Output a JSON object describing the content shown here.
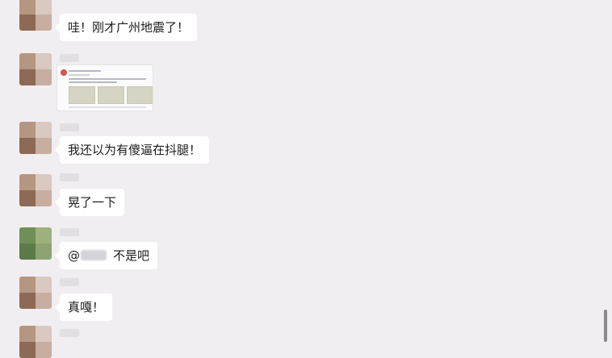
{
  "messages": [
    {
      "id": 1,
      "avatar": "blurred-avatar-brown",
      "text": "哇！刚才广州地震了！"
    },
    {
      "id": 2,
      "avatar": "blurred-avatar-brown",
      "type": "image",
      "image": "news-post-screenshot-thumbnail"
    },
    {
      "id": 3,
      "avatar": "blurred-avatar-brown",
      "text": "我还以为有傻逼在抖腿！"
    },
    {
      "id": 4,
      "avatar": "blurred-avatar-brown",
      "text": "晃了一下"
    },
    {
      "id": 5,
      "avatar": "blurred-avatar-green",
      "mention_prefix": "@",
      "text": "不是吧"
    },
    {
      "id": 6,
      "avatar": "blurred-avatar-brown",
      "text": "真嘎！"
    },
    {
      "id": 7,
      "avatar": "blurred-avatar-brown",
      "text": ""
    }
  ],
  "colors": {
    "background": "#f1eef1",
    "bubble": "#ffffff",
    "text": "#1b1b1b",
    "scrollbar": "#8a8a8a"
  }
}
